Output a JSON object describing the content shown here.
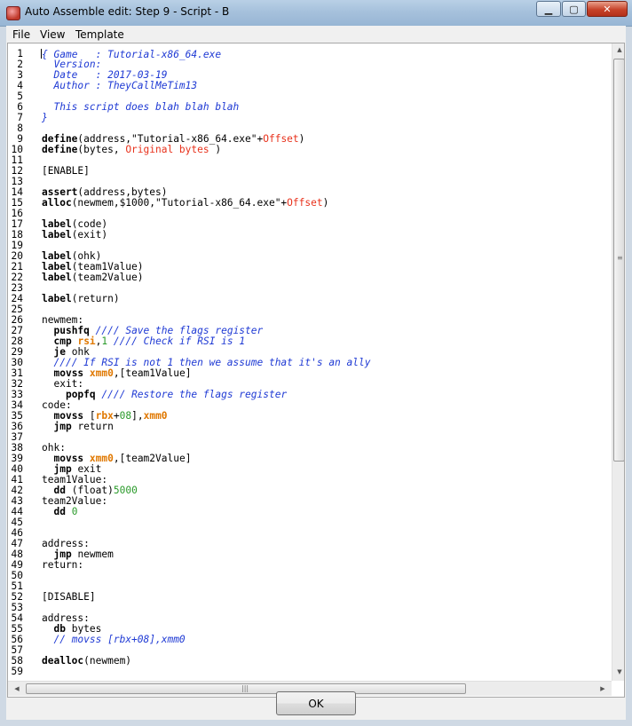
{
  "window": {
    "title": "Auto Assemble edit: Step 9 - Script - B",
    "min_glyph": "▁",
    "max_glyph": "▢",
    "close_glyph": "✕"
  },
  "menu": [
    "File",
    "View",
    "Template"
  ],
  "editor": {
    "lines": [
      [
        {
          "t": "{ ",
          "s": "c"
        },
        {
          "t": "Game   : Tutorial-x86_64.exe",
          "s": "c"
        }
      ],
      [
        {
          "t": "  Version:",
          "s": "c"
        }
      ],
      [
        {
          "t": "  Date   : 2017-03-19",
          "s": "c"
        }
      ],
      [
        {
          "t": "  Author : TheyCallMeTim13",
          "s": "c"
        }
      ],
      [],
      [
        {
          "t": "  This script does blah blah blah",
          "s": "c"
        }
      ],
      [
        {
          "t": "}",
          "s": "c"
        }
      ],
      [],
      [
        {
          "t": "define",
          "s": "k"
        },
        {
          "t": "(address,\"Tutorial-x86_64.exe\"+"
        },
        {
          "t": "Offset",
          "s": "r"
        },
        {
          "t": ")"
        }
      ],
      [
        {
          "t": "define",
          "s": "k"
        },
        {
          "t": "(bytes, "
        },
        {
          "t": "Original bytes",
          "s": "r"
        },
        {
          "t": " )"
        }
      ],
      [],
      [
        {
          "t": "[ENABLE]"
        }
      ],
      [],
      [
        {
          "t": "assert",
          "s": "k"
        },
        {
          "t": "(address,bytes)"
        }
      ],
      [
        {
          "t": "alloc",
          "s": "k"
        },
        {
          "t": "(newmem,$1000,\"Tutorial-x86_64.exe\"+"
        },
        {
          "t": "Offset",
          "s": "r"
        },
        {
          "t": ")"
        }
      ],
      [],
      [
        {
          "t": "label",
          "s": "k"
        },
        {
          "t": "(code)"
        }
      ],
      [
        {
          "t": "label",
          "s": "k"
        },
        {
          "t": "(exit)"
        }
      ],
      [],
      [
        {
          "t": "label",
          "s": "k"
        },
        {
          "t": "(ohk)"
        }
      ],
      [
        {
          "t": "label",
          "s": "k"
        },
        {
          "t": "(team1Value)"
        }
      ],
      [
        {
          "t": "label",
          "s": "k"
        },
        {
          "t": "(team2Value)"
        }
      ],
      [],
      [
        {
          "t": "label",
          "s": "k"
        },
        {
          "t": "(return)"
        }
      ],
      [],
      [
        {
          "t": "newmem:"
        }
      ],
      [
        {
          "t": "  "
        },
        {
          "t": "pushfq",
          "s": "k"
        },
        {
          "t": " "
        },
        {
          "t": "//// Save the flags register",
          "s": "c"
        }
      ],
      [
        {
          "t": "  "
        },
        {
          "t": "cmp",
          "s": "k"
        },
        {
          "t": " "
        },
        {
          "t": "rsi",
          "s": "o"
        },
        {
          "t": ","
        },
        {
          "t": "1",
          "s": "g"
        },
        {
          "t": " "
        },
        {
          "t": "//// Check if RSI is 1",
          "s": "c"
        }
      ],
      [
        {
          "t": "  "
        },
        {
          "t": "je",
          "s": "k"
        },
        {
          "t": " ohk"
        }
      ],
      [
        {
          "t": "  "
        },
        {
          "t": "//// If RSI is not 1 then we assume that it's an ally",
          "s": "c"
        }
      ],
      [
        {
          "t": "  "
        },
        {
          "t": "movss",
          "s": "k"
        },
        {
          "t": " "
        },
        {
          "t": "xmm0",
          "s": "o"
        },
        {
          "t": ",[team1Value]"
        }
      ],
      [
        {
          "t": "  exit:"
        }
      ],
      [
        {
          "t": "    "
        },
        {
          "t": "popfq",
          "s": "k"
        },
        {
          "t": " "
        },
        {
          "t": "//// Restore the flags register",
          "s": "c"
        }
      ],
      [
        {
          "t": "code:"
        }
      ],
      [
        {
          "t": "  "
        },
        {
          "t": "movss",
          "s": "k"
        },
        {
          "t": " ["
        },
        {
          "t": "rbx",
          "s": "o"
        },
        {
          "t": "+"
        },
        {
          "t": "08",
          "s": "g"
        },
        {
          "t": "],"
        },
        {
          "t": "xmm0",
          "s": "o"
        }
      ],
      [
        {
          "t": "  "
        },
        {
          "t": "jmp",
          "s": "k"
        },
        {
          "t": " return"
        }
      ],
      [],
      [
        {
          "t": "ohk:"
        }
      ],
      [
        {
          "t": "  "
        },
        {
          "t": "movss",
          "s": "k"
        },
        {
          "t": " "
        },
        {
          "t": "xmm0",
          "s": "o"
        },
        {
          "t": ",[team2Value]"
        }
      ],
      [
        {
          "t": "  "
        },
        {
          "t": "jmp",
          "s": "k"
        },
        {
          "t": " exit"
        }
      ],
      [
        {
          "t": "team1Value:"
        }
      ],
      [
        {
          "t": "  "
        },
        {
          "t": "dd",
          "s": "k"
        },
        {
          "t": " (float)"
        },
        {
          "t": "5000",
          "s": "g"
        }
      ],
      [
        {
          "t": "team2Value:"
        }
      ],
      [
        {
          "t": "  "
        },
        {
          "t": "dd",
          "s": "k"
        },
        {
          "t": " "
        },
        {
          "t": "0",
          "s": "g"
        }
      ],
      [],
      [],
      [
        {
          "t": "address:"
        }
      ],
      [
        {
          "t": "  "
        },
        {
          "t": "jmp",
          "s": "k"
        },
        {
          "t": " newmem"
        }
      ],
      [
        {
          "t": "return:"
        }
      ],
      [],
      [],
      [
        {
          "t": "[DISABLE]"
        }
      ],
      [],
      [
        {
          "t": "address:"
        }
      ],
      [
        {
          "t": "  "
        },
        {
          "t": "db",
          "s": "k"
        },
        {
          "t": " bytes"
        }
      ],
      [
        {
          "t": "  "
        },
        {
          "t": "// movss [rbx+08],xmm0",
          "s": "c"
        }
      ],
      [],
      [
        {
          "t": "dealloc",
          "s": "k"
        },
        {
          "t": "(newmem)"
        }
      ],
      []
    ]
  },
  "buttons": {
    "ok": "OK"
  },
  "colors": {
    "comment": "#1f3ad4",
    "symbol": "#e8321c",
    "number": "#2a9a2a",
    "register": "#e07800"
  },
  "icons": [
    "app-icon",
    "minimize-icon",
    "maximize-icon",
    "close-icon",
    "scroll-up-icon",
    "scroll-down-icon",
    "scroll-left-icon",
    "scroll-right-icon"
  ]
}
